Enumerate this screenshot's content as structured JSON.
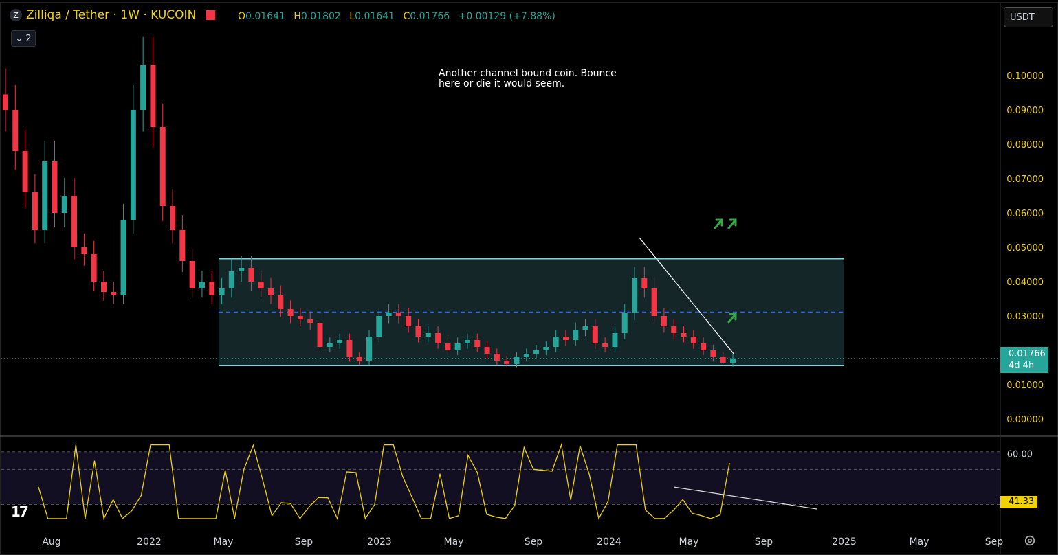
{
  "header": {
    "title": "Zilliqa / Tether · 1W · KUCOIN",
    "ohlc": [
      {
        "k": "O",
        "v": "0.01641"
      },
      {
        "k": "H",
        "v": "0.01802"
      },
      {
        "k": "L",
        "v": "0.01641"
      },
      {
        "k": "C",
        "v": "0.01766"
      }
    ],
    "change": "+0.00129 (+7.88%)",
    "indicator_count": "2"
  },
  "currency_button": "USDT",
  "annotation": "Another channel bound coin. Bounce here or die it would seem.",
  "price_tag": {
    "price": "0.01766",
    "countdown": "4d 4h"
  },
  "rsi_tag": "41.33",
  "colors": {
    "up": "#26a69a",
    "down": "#f23645",
    "channel": "#7fd3e0",
    "rsi": "#f0d300",
    "annot_arrow": "#3aa64a"
  },
  "chart_data": {
    "type": "candlestick",
    "symbol": "Zilliqa / Tether",
    "interval": "1W",
    "exchange": "KUCOIN",
    "y_axis": {
      "ticks": [
        "0.10000",
        "0.09000",
        "0.08000",
        "0.07000",
        "0.06000",
        "0.05000",
        "0.04000",
        "0.03000",
        "0.02000",
        "0.01000",
        "0.00000"
      ],
      "range": [
        0,
        0.11
      ]
    },
    "x_axis": {
      "ticks": [
        "Aug",
        "2022",
        "May",
        "Sep",
        "2023",
        "May",
        "Sep",
        "2024",
        "May",
        "Sep",
        "2025",
        "May",
        "Sep"
      ]
    },
    "channel": {
      "top": 0.0467,
      "bottom": 0.0156,
      "mid": 0.0311
    },
    "last_price": 0.01766,
    "closes": [
      0.09,
      0.078,
      0.066,
      0.055,
      0.075,
      0.06,
      0.065,
      0.05,
      0.048,
      0.04,
      0.037,
      0.036,
      0.058,
      0.09,
      0.103,
      0.085,
      0.062,
      0.055,
      0.046,
      0.038,
      0.04,
      0.036,
      0.038,
      0.043,
      0.044,
      0.04,
      0.038,
      0.036,
      0.032,
      0.03,
      0.029,
      0.028,
      0.021,
      0.022,
      0.023,
      0.018,
      0.017,
      0.024,
      0.03,
      0.031,
      0.03,
      0.027,
      0.024,
      0.025,
      0.022,
      0.02,
      0.022,
      0.023,
      0.021,
      0.019,
      0.017,
      0.016,
      0.018,
      0.019,
      0.02,
      0.021,
      0.024,
      0.023,
      0.026,
      0.027,
      0.022,
      0.021,
      0.025,
      0.031,
      0.041,
      0.038,
      0.03,
      0.027,
      0.025,
      0.024,
      0.022,
      0.02,
      0.018,
      0.01641,
      0.01766
    ],
    "rsi": {
      "ticks": [
        "60.00"
      ],
      "last": 41.33,
      "upper_band": 70,
      "mid_band": 60,
      "lower_band": 40
    }
  }
}
